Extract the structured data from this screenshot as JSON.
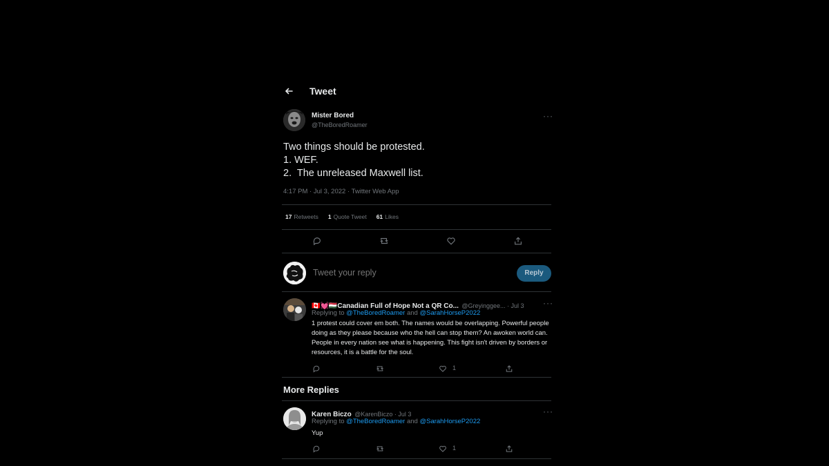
{
  "header": {
    "title": "Tweet"
  },
  "tweet": {
    "author_name": "Mister Bored",
    "author_handle": "@TheBoredRoamer",
    "text_lines": [
      "Two things should be protested.",
      "1. WEF.",
      "2.  The unreleased Maxwell list."
    ],
    "meta": "4:17 PM · Jul 3, 2022 · Twitter Web App",
    "stats": {
      "retweets_count": "17",
      "retweets_label": "Retweets",
      "quotes_count": "1",
      "quotes_label": "Quote Tweet",
      "likes_count": "61",
      "likes_label": "Likes"
    }
  },
  "compose": {
    "placeholder": "Tweet your reply",
    "button_label": "Reply"
  },
  "replies": [
    {
      "name": "🇨🇦💓🇭🇺Canadian Full of Hope Not a QR Co...",
      "meta": "@Greyinggee... · Jul 3",
      "replying_prefix": "Replying to",
      "replying_user1": "@TheBoredRoamer",
      "replying_and": "and",
      "replying_user2": "@SarahHorseP2022",
      "body": "1 protest could cover em both. The names would be overlapping. Powerful people doing as they please because who the hell can stop them? An awoken world can. People in every nation see what is happening. This fight isn't driven by borders or resources, it is a battle for the soul.",
      "like_count": "1"
    }
  ],
  "more_replies": {
    "title": "More Replies",
    "items": [
      {
        "name": "Karen Biczo",
        "meta": "@KarenBiczo · Jul 3",
        "replying_prefix": "Replying to",
        "replying_user1": "@TheBoredRoamer",
        "replying_and": "and",
        "replying_user2": "@SarahHorseP2022",
        "body": "Yup",
        "like_count": "1"
      }
    ]
  },
  "colors": {
    "background": "#000000",
    "text": "#e7e9ea",
    "muted": "#71767b",
    "link": "#1d9bf0",
    "reply_button": "#1b5a7e"
  }
}
